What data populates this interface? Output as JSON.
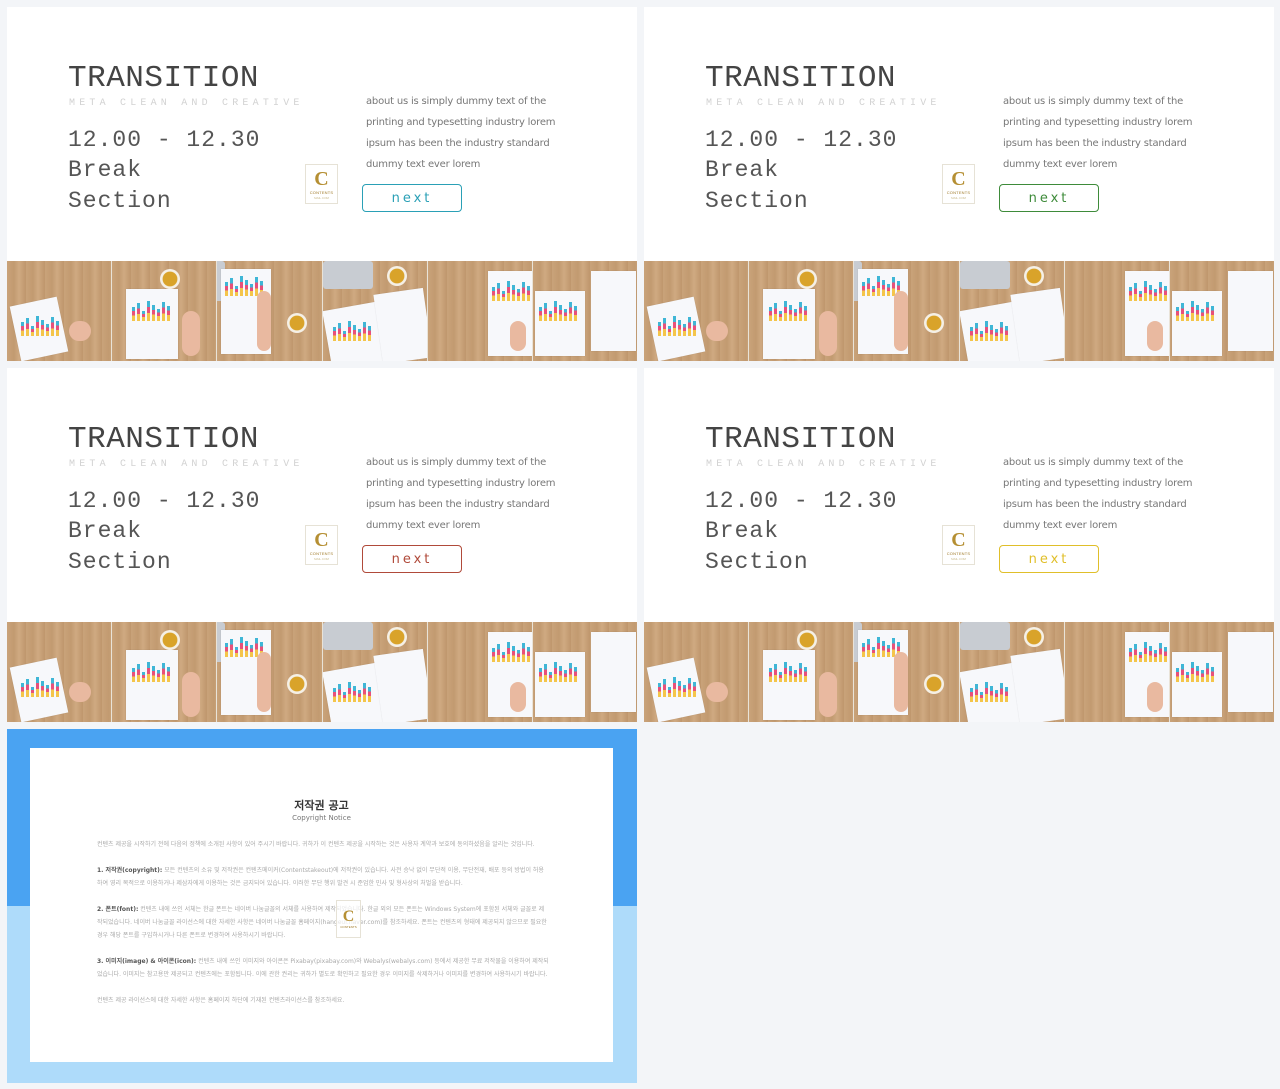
{
  "slides": [
    {
      "title": "TRANSITION",
      "subtitle": "META CLEAN AND CREATIVE",
      "time": "12.00 - 12.30",
      "label_line1": "Break",
      "label_line2": "Section",
      "body_text": "about us is simply dummy text of the printing and typesetting industry lorem ipsum has been the industry standard dummy text ever lorem",
      "button_label": "next",
      "button_color": "#2aa0b6"
    },
    {
      "title": "TRANSITION",
      "subtitle": "META CLEAN AND CREATIVE",
      "time": "12.00 - 12.30",
      "label_line1": "Break",
      "label_line2": "Section",
      "body_text": "about us is simply dummy text of the printing and typesetting industry lorem ipsum has been the industry standard dummy text ever lorem",
      "button_label": "next",
      "button_color": "#3e8b3a"
    },
    {
      "title": "TRANSITION",
      "subtitle": "META CLEAN AND CREATIVE",
      "time": "12.00 - 12.30",
      "label_line1": "Break",
      "label_line2": "Section",
      "body_text": "about us is simply dummy text of the printing and typesetting industry lorem ipsum has been the industry standard dummy text ever lorem",
      "button_label": "next",
      "button_color": "#b04a3a"
    },
    {
      "title": "TRANSITION",
      "subtitle": "META CLEAN AND CREATIVE",
      "time": "12.00 - 12.30",
      "label_line1": "Break",
      "label_line2": "Section",
      "body_text": "about us is simply dummy text of the printing and typesetting industry lorem ipsum has been the industry standard dummy text ever lorem",
      "button_label": "next",
      "button_color": "#e0bf2a"
    }
  ],
  "logo": {
    "letter": "C",
    "text": "CONTENTS",
    "subtext": "MAIL.COM"
  },
  "notice": {
    "title": "저작권 공고",
    "subtitle": "Copyright Notice",
    "intro": "컨텐츠 제공을 시작하기 전에 다음의 정책에 소개된 사항이 있어 주시기 바랍니다. 귀하가 이 컨텐츠 제공을 시작하는 것은 사용자 계약과 보호에 동의하셨음을 알리는 것입니다.",
    "sections": [
      {
        "heading": "1. 저작권(copyright):",
        "text": "모든 컨텐츠의 소유 및 저작권은 컨텐츠메이커(Contentstakeout)에 저작권이 있습니다. 사전 승낙 없이 무단적 이용, 무단전재, 배포 등의 방법이 허용하여 영리 목적으로 이용하거나 제삼자에게 이용하는 것은 금지되어 있습니다. 이러한 무단 행위 발견 시 준엄한 민사 및 형사상의 처벌을 받습니다."
      },
      {
        "heading": "2. 폰트(font):",
        "text": "컨텐츠 내에 쓰인 서체는 한글 폰트는 네이버 나눔글꼴의 서체를 사용하여 제작되었습니다. 한글 외의 모든 폰트는 Windows System에 포함된 서체와 글꼴로 제작되었습니다. 네이버 나눔글꼴 라이선스에 대한 자세한 사항은 네이버 나눔글꼴 홈페이지(hangeul.naver.com)를 참조하세요. 폰트는 컨텐츠의 형태에 제공되지 않으므로 필요한 경우 해당 폰트를 구입하시거나 다른 폰트로 변경하여 사용하시기 바랍니다."
      },
      {
        "heading": "3. 이미지(image) & 아이콘(icon):",
        "text": "컨텐츠 내에 쓰인 이미지와 아이콘은 Pixabay(pixabay.com)와 Webalys(webalys.com) 등에서 제공한 무료 저작물을 이용하여 제작되었습니다. 이미지는 참고용만 제공되고 컨텐츠에는 포함됩니다. 이에 관한 권리는 귀하가 별도로 확인하고 필요한 경우 이미지를 삭제하거나 이미지를 변경하여 사용하시기 바랍니다."
      }
    ],
    "footer": "컨텐츠 제공 라이선스에 대한 자세한 사항은 홈페이지 하단에 기재된 컨텐츠라이선스를 참조하세요."
  }
}
